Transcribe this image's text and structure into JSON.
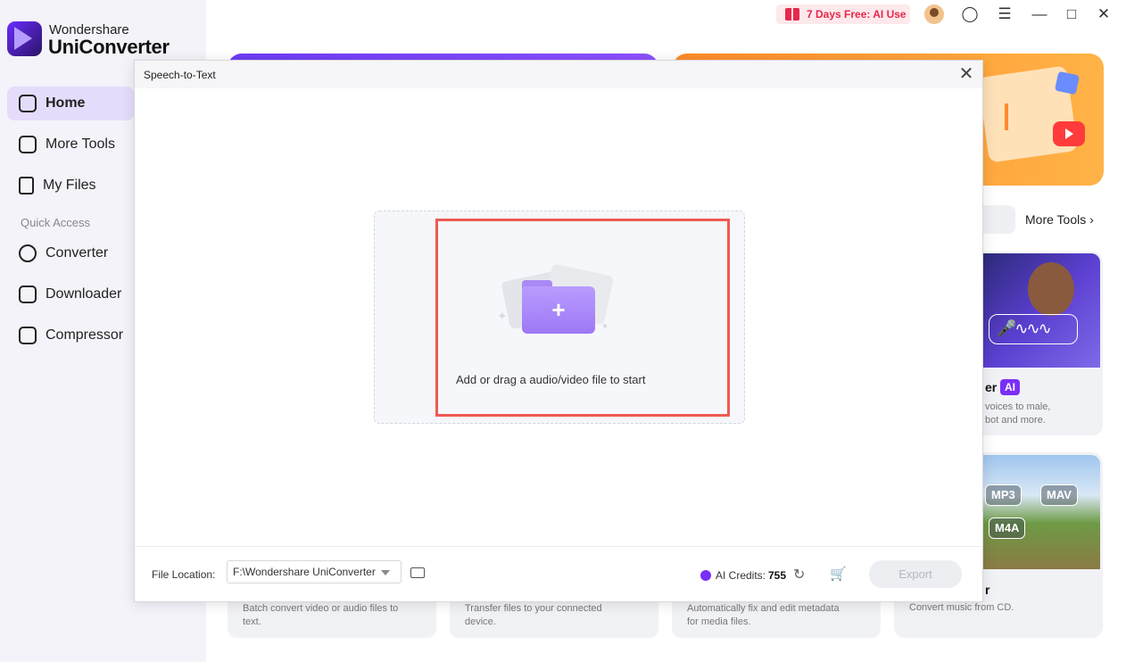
{
  "app": {
    "brand_line1": "Wondershare",
    "brand_line2": "UniConverter"
  },
  "titlebar": {
    "promo_text": "7 Days Free: AI Use",
    "icons": [
      "gift-icon",
      "avatar",
      "headset-icon",
      "menu-icon",
      "minimize-icon",
      "maximize-icon",
      "close-icon"
    ]
  },
  "sidebar": {
    "items": [
      {
        "label": "Home",
        "icon": "home-icon",
        "active": true
      },
      {
        "label": "More Tools",
        "icon": "toolbox-icon"
      },
      {
        "label": "My Files",
        "icon": "file-icon"
      }
    ],
    "quick_access_label": "Quick Access",
    "quick_items": [
      {
        "label": "Converter",
        "icon": "converter-icon"
      },
      {
        "label": "Downloader",
        "icon": "downloader-icon"
      },
      {
        "label": "Compressor",
        "icon": "compressor-icon"
      }
    ]
  },
  "background": {
    "more_tools_link": "More Tools",
    "card1": {
      "title_fragment": "er",
      "badge": "AI",
      "desc_line1": "voices to male,",
      "desc_line2": "bot and more."
    },
    "card2": {
      "title_fragment": "r",
      "desc": "Convert music from CD.",
      "formats": [
        "MP3",
        "MAV",
        "M4A"
      ]
    },
    "bottom_cards": [
      {
        "desc_line1": "Batch convert video or audio files to",
        "desc_line2": "text."
      },
      {
        "desc_line1": "Transfer files to your connected",
        "desc_line2": "device."
      },
      {
        "desc_line1": "Automatically fix and edit metadata",
        "desc_line2": "for media files."
      }
    ]
  },
  "dialog": {
    "title": "Speech-to-Text",
    "drop_text": "Add or drag a audio/video file to start",
    "file_location_label": "File Location:",
    "file_location_value": "F:\\Wondershare UniConverter",
    "ai_credits_label": "AI Credits:",
    "ai_credits_value": "755",
    "export_label": "Export"
  }
}
